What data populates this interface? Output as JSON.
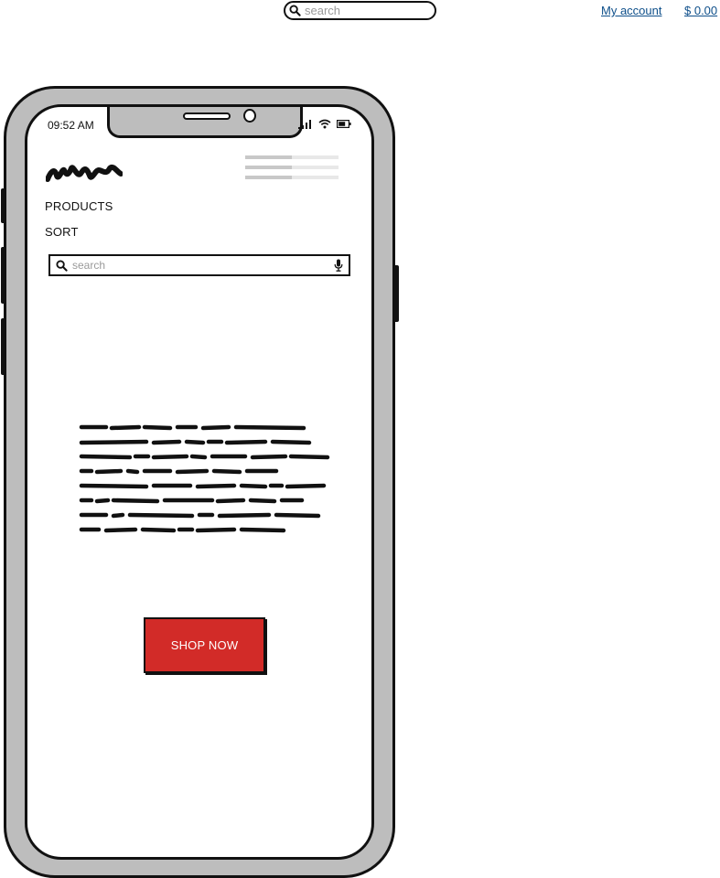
{
  "header": {
    "search_placeholder": "search",
    "account_link": "My account",
    "cart_total": "$ 0.00"
  },
  "phone": {
    "status_time": "09:52 AM",
    "status_icons": [
      "signal-icon",
      "wifi-icon",
      "battery-icon"
    ]
  },
  "app": {
    "nav": {
      "products": "PRODUCTS",
      "sort": "SORT"
    },
    "search_placeholder": "search",
    "cta_label": "SHOP NOW"
  },
  "colors": {
    "cta": "#d22b28",
    "link": "#0e4f8a",
    "frame": "#bdbdbd"
  }
}
